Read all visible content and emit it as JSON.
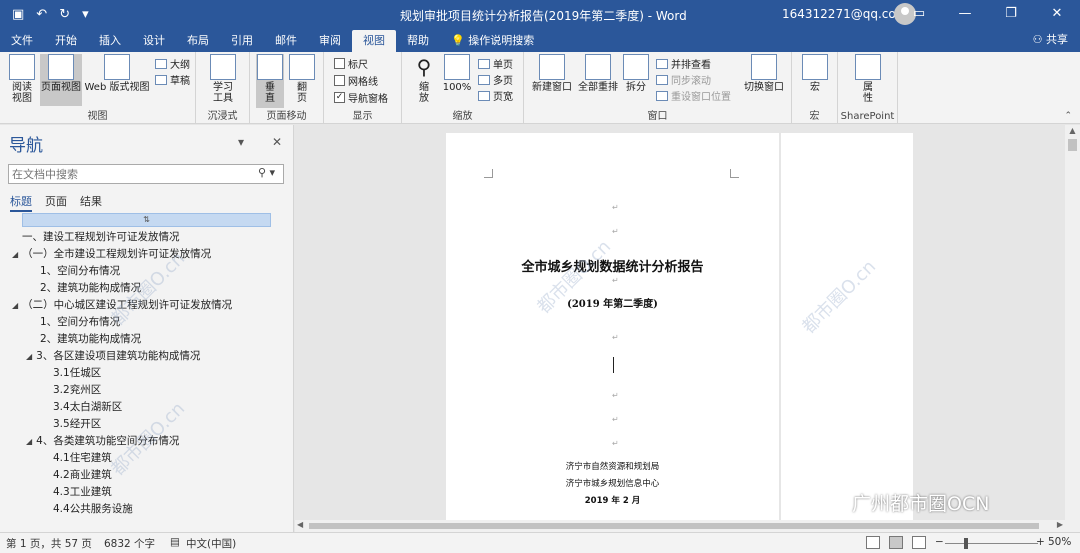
{
  "window": {
    "title": "规划审批项目统计分析报告(2019年第二季度) - Word",
    "account": "164312271@qq.com",
    "qat_icons": [
      "save-icon",
      "undo-icon",
      "redo-icon",
      "customize-icon"
    ],
    "controls": [
      "ribbon-display-icon",
      "minimize-icon",
      "restore-icon",
      "close-icon"
    ]
  },
  "tabs": [
    "文件",
    "开始",
    "插入",
    "设计",
    "布局",
    "引用",
    "邮件",
    "审阅",
    "视图",
    "帮助",
    "操作说明搜索"
  ],
  "active_tab": "视图",
  "share_label": "共享",
  "ribbon": {
    "views": {
      "label": "视图",
      "read": "阅读\n视图",
      "print": "页面视图",
      "web": "Web 版式视图",
      "outline": "大纲",
      "draft": "草稿"
    },
    "immersive": {
      "label": "沉浸式",
      "learn": "学习\n工具"
    },
    "pagemove": {
      "label": "页面移动",
      "vertical": "垂\n直",
      "sidetoside": "翻\n页"
    },
    "show": {
      "label": "显示",
      "ruler": "标尺",
      "gridlines": "网格线",
      "navpane": "导航窗格",
      "navpane_checked": true
    },
    "zoom": {
      "label": "缩放",
      "zoom": "缩\n放",
      "hundred": "100%",
      "single": "单页",
      "multi": "多页",
      "width": "页宽"
    },
    "window": {
      "label": "窗口",
      "new": "新建窗口",
      "arrange": "全部重排",
      "split": "拆分",
      "side": "并排查看",
      "sync": "同步滚动",
      "reset": "重设窗口位置",
      "switch": "切换窗口"
    },
    "macros": {
      "label": "宏",
      "macro": "宏"
    },
    "sharepoint": {
      "label": "SharePoint",
      "props": "属\n性"
    }
  },
  "nav": {
    "title": "导航",
    "search_placeholder": "在文档中搜索",
    "tabs": [
      "标题",
      "页面",
      "结果"
    ],
    "top_marker": "⇅",
    "items": [
      {
        "text": "一、建设工程规划许可证发放情况",
        "tri": ""
      },
      {
        "text": "（一）全市建设工程规划许可证发放情况",
        "tri": "◢"
      },
      {
        "text": "1、空间分布情况",
        "tri": ""
      },
      {
        "text": "2、建筑功能构成情况",
        "tri": ""
      },
      {
        "text": "（二）中心城区建设工程规划许可证发放情况",
        "tri": "◢"
      },
      {
        "text": "1、空间分布情况",
        "tri": ""
      },
      {
        "text": "2、建筑功能构成情况",
        "tri": ""
      },
      {
        "text": "3、各区建设项目建筑功能构成情况",
        "tri": "◢"
      },
      {
        "text": "3.1任城区",
        "tri": ""
      },
      {
        "text": "3.2兖州区",
        "tri": ""
      },
      {
        "text": "3.4太白湖新区",
        "tri": ""
      },
      {
        "text": "3.5经开区",
        "tri": ""
      },
      {
        "text": "4、各类建筑功能空间分布情况",
        "tri": "◢"
      },
      {
        "text": "4.1住宅建筑",
        "tri": ""
      },
      {
        "text": "4.2商业建筑",
        "tri": ""
      },
      {
        "text": "4.3工业建筑",
        "tri": ""
      },
      {
        "text": "4.4公共服务设施",
        "tri": ""
      }
    ]
  },
  "document": {
    "title": "全市城乡规划数据统计分析报告",
    "subtitle": "(2019 年第二季度)",
    "org1": "济宁市自然资源和规划局",
    "org2": "济宁市城乡规划信息中心",
    "date": "2019 年 2 月"
  },
  "watermark": {
    "text": "广州都市圈OCN",
    "ghost": "都市圈O.cn"
  },
  "status": {
    "page": "第 1 页，共 57 页",
    "words": "6832 个字",
    "language": "中文(中国)",
    "zoom": "50%",
    "zoom_value": 50
  }
}
